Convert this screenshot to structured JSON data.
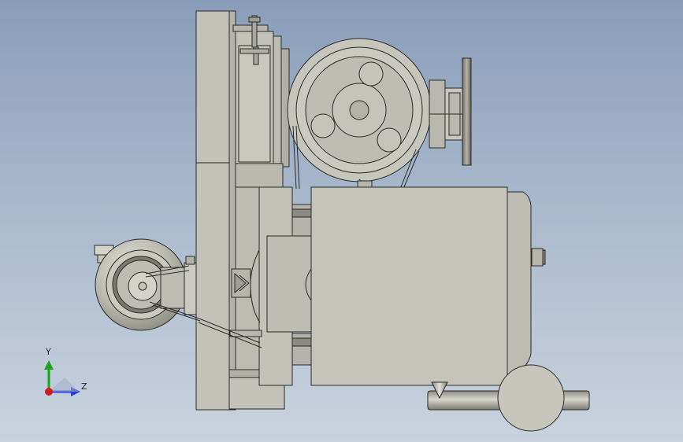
{
  "colors": {
    "part_fill": "#c2c2b8",
    "part_fill_light": "#d0d0c6",
    "part_fill_dark": "#9e9e94",
    "edge": "#2a2a2a",
    "axis_x": "#2a3fd6",
    "axis_y": "#17a51a",
    "axis_origin": "#d21a1a"
  },
  "triad": {
    "y_label": "Y",
    "z_label": "Z"
  }
}
